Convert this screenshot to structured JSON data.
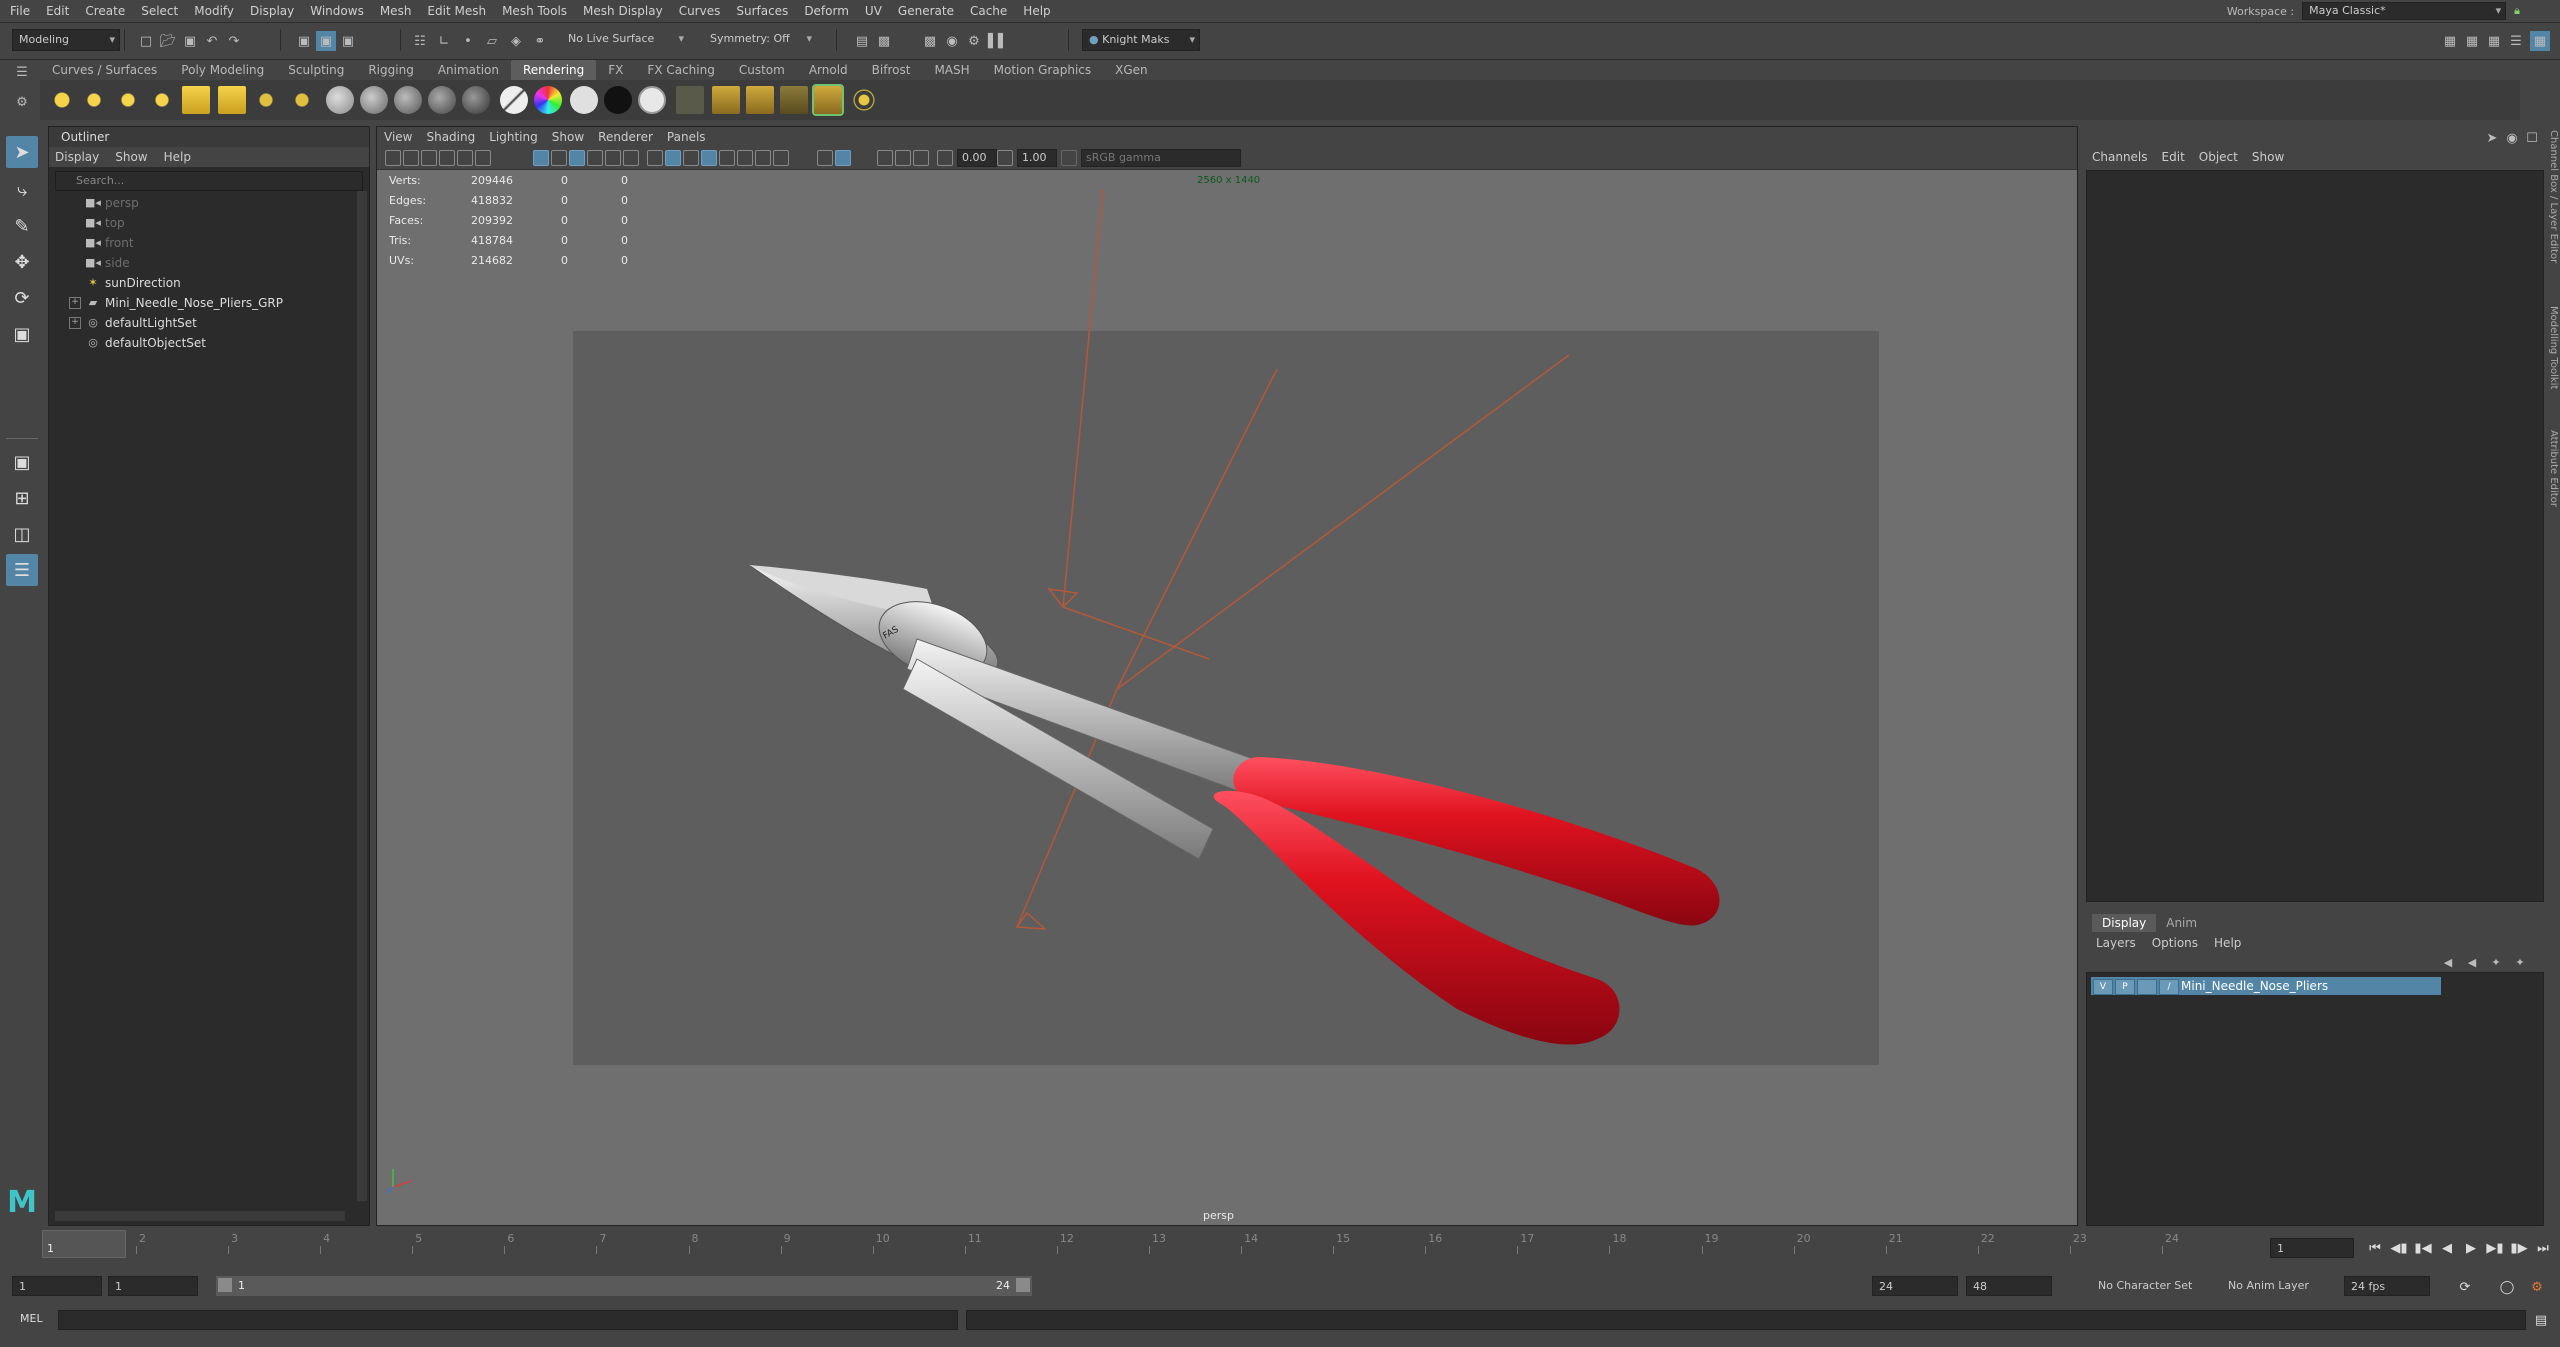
{
  "menubar": {
    "items": [
      "File",
      "Edit",
      "Create",
      "Select",
      "Modify",
      "Display",
      "Windows",
      "Mesh",
      "Edit Mesh",
      "Mesh Tools",
      "Mesh Display",
      "Curves",
      "Surfaces",
      "Deform",
      "UV",
      "Generate",
      "Cache",
      "Help"
    ],
    "workspace_label": "Workspace :",
    "workspace_value": "Maya Classic*"
  },
  "statusline": {
    "mode": "Modeling",
    "live_surface": "No Live Surface",
    "symmetry": "Symmetry: Off",
    "user": "Knight Maks"
  },
  "shelf": {
    "tabs": [
      "Curves / Surfaces",
      "Poly Modeling",
      "Sculpting",
      "Rigging",
      "Animation",
      "Rendering",
      "FX",
      "FX Caching",
      "Custom",
      "Arnold",
      "Bifrost",
      "MASH",
      "Motion Graphics",
      "XGen"
    ],
    "active_tab": "Rendering"
  },
  "outliner": {
    "title": "Outliner",
    "menus": [
      "Display",
      "Show",
      "Help"
    ],
    "search_placeholder": "Search...",
    "items": [
      {
        "label": "persp",
        "icon": "camera-icon",
        "dim": true,
        "expandable": false
      },
      {
        "label": "top",
        "icon": "camera-icon",
        "dim": true,
        "expandable": false
      },
      {
        "label": "front",
        "icon": "camera-icon",
        "dim": true,
        "expandable": false
      },
      {
        "label": "side",
        "icon": "camera-icon",
        "dim": true,
        "expandable": false
      },
      {
        "label": "sunDirection",
        "icon": "light-icon",
        "dim": false,
        "expandable": false
      },
      {
        "label": "Mini_Needle_Nose_Pliers_GRP",
        "icon": "group-icon",
        "dim": false,
        "expandable": true
      },
      {
        "label": "defaultLightSet",
        "icon": "set-icon",
        "dim": false,
        "expandable": true
      },
      {
        "label": "defaultObjectSet",
        "icon": "set-icon",
        "dim": false,
        "expandable": false
      }
    ]
  },
  "viewport": {
    "menus": [
      "View",
      "Shading",
      "Lighting",
      "Show",
      "Renderer",
      "Panels"
    ],
    "exposure": "0.00",
    "gamma": "1.00",
    "color_space": "sRGB gamma",
    "resolution": "2560 x 1440",
    "camera": "persp",
    "hud": [
      {
        "label": "Verts:",
        "v1": "209446",
        "v2": "0",
        "v3": "0"
      },
      {
        "label": "Edges:",
        "v1": "418832",
        "v2": "0",
        "v3": "0"
      },
      {
        "label": "Faces:",
        "v1": "209392",
        "v2": "0",
        "v3": "0"
      },
      {
        "label": "Tris:",
        "v1": "418784",
        "v2": "0",
        "v3": "0"
      },
      {
        "label": "UVs:",
        "v1": "214682",
        "v2": "0",
        "v3": "0"
      }
    ],
    "model_engraving": "FAS"
  },
  "channelbox": {
    "menus": [
      "Channels",
      "Edit",
      "Object",
      "Show"
    ],
    "layer_tabs": [
      "Display",
      "Anim"
    ],
    "layer_menus": [
      "Layers",
      "Options",
      "Help"
    ],
    "layer": {
      "v": "V",
      "p": "P",
      "name": "Mini_Needle_Nose_Pliers"
    },
    "side_tabs": [
      "Channel Box / Layer Editor",
      "Modelling Toolkit",
      "Attribute Editor"
    ]
  },
  "timeslider": {
    "ticks": [
      "2",
      "3",
      "4",
      "5",
      "6",
      "7",
      "8",
      "9",
      "10",
      "11",
      "12",
      "13",
      "14",
      "15",
      "16",
      "17",
      "18",
      "19",
      "20",
      "21",
      "22",
      "23",
      "24"
    ],
    "current_frame": "1",
    "current_field": "1"
  },
  "range": {
    "start": "1",
    "start_inner": "1",
    "range_start": "1",
    "range_end": "24",
    "end": "24",
    "anim_end": "48",
    "character_set": "No Character Set",
    "anim_layer": "No Anim Layer",
    "fps": "24 fps"
  },
  "cmdline": {
    "label": "MEL"
  },
  "colors": {
    "accent": "#5285a6",
    "handle_red": "#d8101f",
    "metal": "#c9c9c9"
  }
}
